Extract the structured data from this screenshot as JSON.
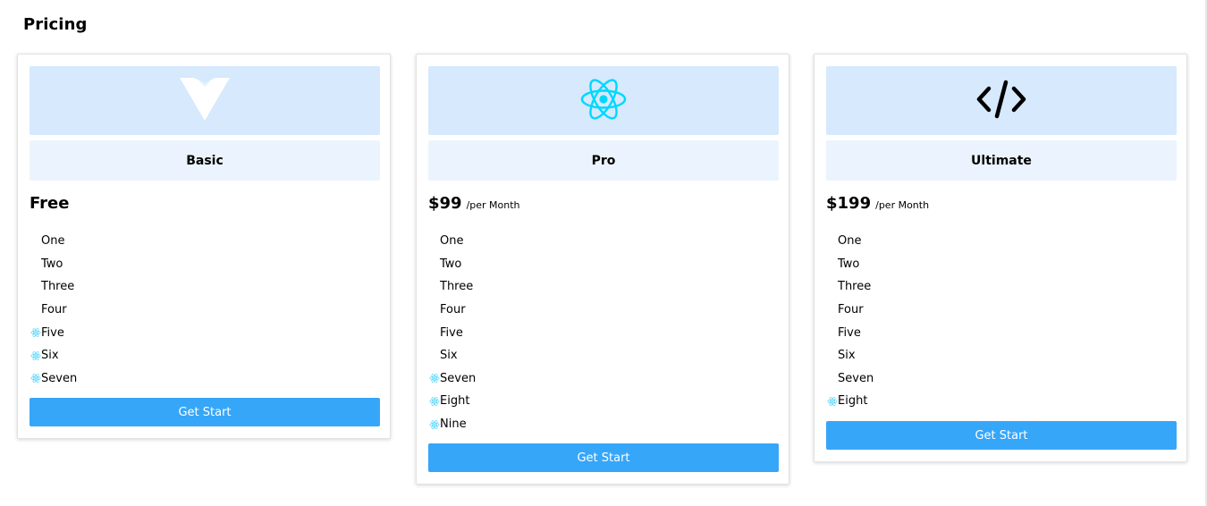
{
  "page": {
    "title": "Pricing"
  },
  "colors": {
    "hero_bg": "#d6e9fd",
    "name_bg": "#ebf4fe",
    "button_bg": "#36a6f9",
    "react_cyan": "#61dafb"
  },
  "plans": [
    {
      "icon": "vuetify-logo-icon",
      "name": "Basic",
      "price": "Free",
      "period": "",
      "features": [
        {
          "label": "One",
          "highlighted": false
        },
        {
          "label": "Two",
          "highlighted": false
        },
        {
          "label": "Three",
          "highlighted": false
        },
        {
          "label": "Four",
          "highlighted": false
        },
        {
          "label": "Five",
          "highlighted": true
        },
        {
          "label": "Six",
          "highlighted": true
        },
        {
          "label": "Seven",
          "highlighted": true
        }
      ],
      "cta": "Get Start"
    },
    {
      "icon": "react-logo-icon",
      "name": "Pro",
      "price": "$99",
      "period": "/per Month",
      "features": [
        {
          "label": "One",
          "highlighted": false
        },
        {
          "label": "Two",
          "highlighted": false
        },
        {
          "label": "Three",
          "highlighted": false
        },
        {
          "label": "Four",
          "highlighted": false
        },
        {
          "label": "Five",
          "highlighted": false
        },
        {
          "label": "Six",
          "highlighted": false
        },
        {
          "label": "Seven",
          "highlighted": true
        },
        {
          "label": "Eight",
          "highlighted": true
        },
        {
          "label": "Nine",
          "highlighted": true
        }
      ],
      "cta": "Get Start"
    },
    {
      "icon": "code-brackets-icon",
      "name": "Ultimate",
      "price": "$199",
      "period": "/per Month",
      "features": [
        {
          "label": "One",
          "highlighted": false
        },
        {
          "label": "Two",
          "highlighted": false
        },
        {
          "label": "Three",
          "highlighted": false
        },
        {
          "label": "Four",
          "highlighted": false
        },
        {
          "label": "Five",
          "highlighted": false
        },
        {
          "label": "Six",
          "highlighted": false
        },
        {
          "label": "Seven",
          "highlighted": false
        },
        {
          "label": "Eight",
          "highlighted": true
        }
      ],
      "cta": "Get Start"
    }
  ]
}
